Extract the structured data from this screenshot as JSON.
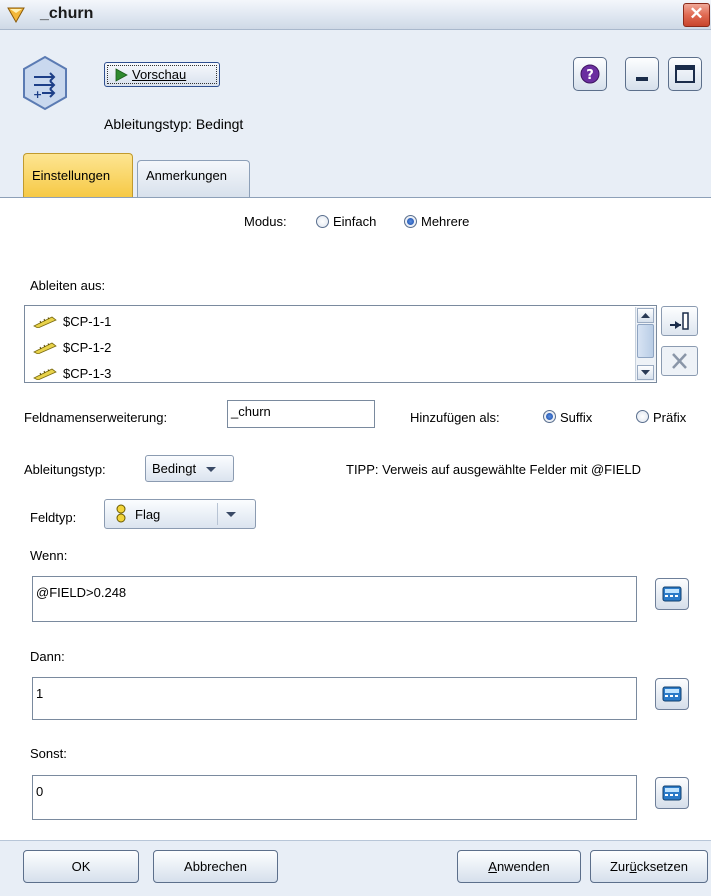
{
  "window": {
    "title": "_churn"
  },
  "header": {
    "preview_label": "Vorschau",
    "subtitle": "Ableitungstyp: Bedingt"
  },
  "tabs": [
    {
      "label": "Einstellungen",
      "selected": true
    },
    {
      "label": "Anmerkungen",
      "selected": false
    }
  ],
  "settings": {
    "mode_label": "Modus:",
    "mode_options": [
      {
        "label": "Einfach",
        "selected": false
      },
      {
        "label": "Mehrere",
        "selected": true
      }
    ],
    "derive_from_label": "Ableiten aus:",
    "derive_from_fields": [
      "$CP-1-1",
      "$CP-1-2",
      "$CP-1-3"
    ],
    "extension_label": "Feldnamenserweiterung:",
    "extension_value": "_churn",
    "add_as_label": "Hinzufügen als:",
    "add_as_options": [
      {
        "label": "Suffix",
        "selected": true
      },
      {
        "label": "Präfix",
        "selected": false
      }
    ],
    "derive_type_label": "Ableitungstyp:",
    "derive_type_value": "Bedingt",
    "tip_text": "TIPP: Verweis auf ausgewählte Felder mit @FIELD",
    "field_type_label": "Feldtyp:",
    "field_type_value": "Flag",
    "if_label": "Wenn:",
    "if_value": "@FIELD>0.248",
    "then_label": "Dann:",
    "then_value": "1",
    "else_label": "Sonst:",
    "else_value": "0"
  },
  "footer": {
    "ok_label": "OK",
    "cancel_label": "Abbrechen",
    "apply_label_first": "A",
    "apply_label_rest": "nwenden",
    "reset_label_first": "Zur",
    "reset_label_u": "ü",
    "reset_label_rest": "cksetzen"
  },
  "colors": {
    "selected_tab": "#f6c945",
    "close_button": "#d9553d",
    "radio_selected": "#1849a7"
  },
  "icons": {
    "window": "derive-node-icon",
    "preview": "play-icon",
    "help": "help-icon",
    "calc": "expression-builder-icon",
    "field": "ruler-icon",
    "flag": "flag-type-icon"
  }
}
